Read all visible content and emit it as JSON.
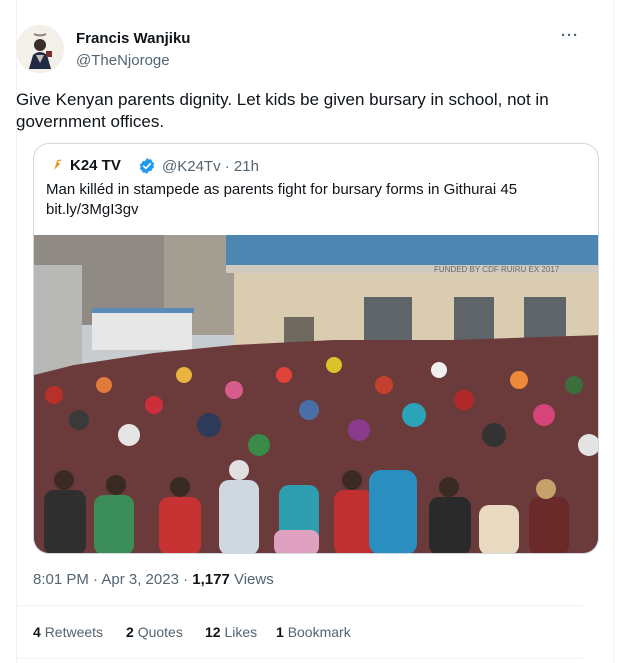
{
  "tweet": {
    "author_name": "Francis Wanjiku",
    "author_handle": "@TheNjoroge",
    "more_label": "···",
    "text": "Give Kenyan parents dignity. Let kids be given bursary in school, not in government offices."
  },
  "quote": {
    "author_name": "K24 TV",
    "meta": "@K24Tv · 21h",
    "text": "Man killéd in stampede as parents fight for bursary forms in Githurai 45",
    "link": "bit.ly/3MgI3gv",
    "building_sign": "FUNDED BY CDF RUIRU EX 2017"
  },
  "timestamp": {
    "datetime": "8:01 PM · Apr 3, 2023 · ",
    "views_count": "1,177",
    "views_label": " Views"
  },
  "stats": [
    {
      "count": "4",
      "label": "Retweets"
    },
    {
      "count": "2",
      "label": "Quotes"
    },
    {
      "count": "12",
      "label": "Likes"
    },
    {
      "count": "1",
      "label": "Bookmark"
    }
  ],
  "colors": {
    "primary_text": "#0f1419",
    "secondary_text": "#536471",
    "border": "#cfd9de",
    "verified": "#1d9bf0",
    "k24_brand": "#e8971a"
  },
  "icons": {
    "verified": "verified-badge-icon",
    "more": "more-options-icon",
    "k24": "k24-logo-icon"
  }
}
